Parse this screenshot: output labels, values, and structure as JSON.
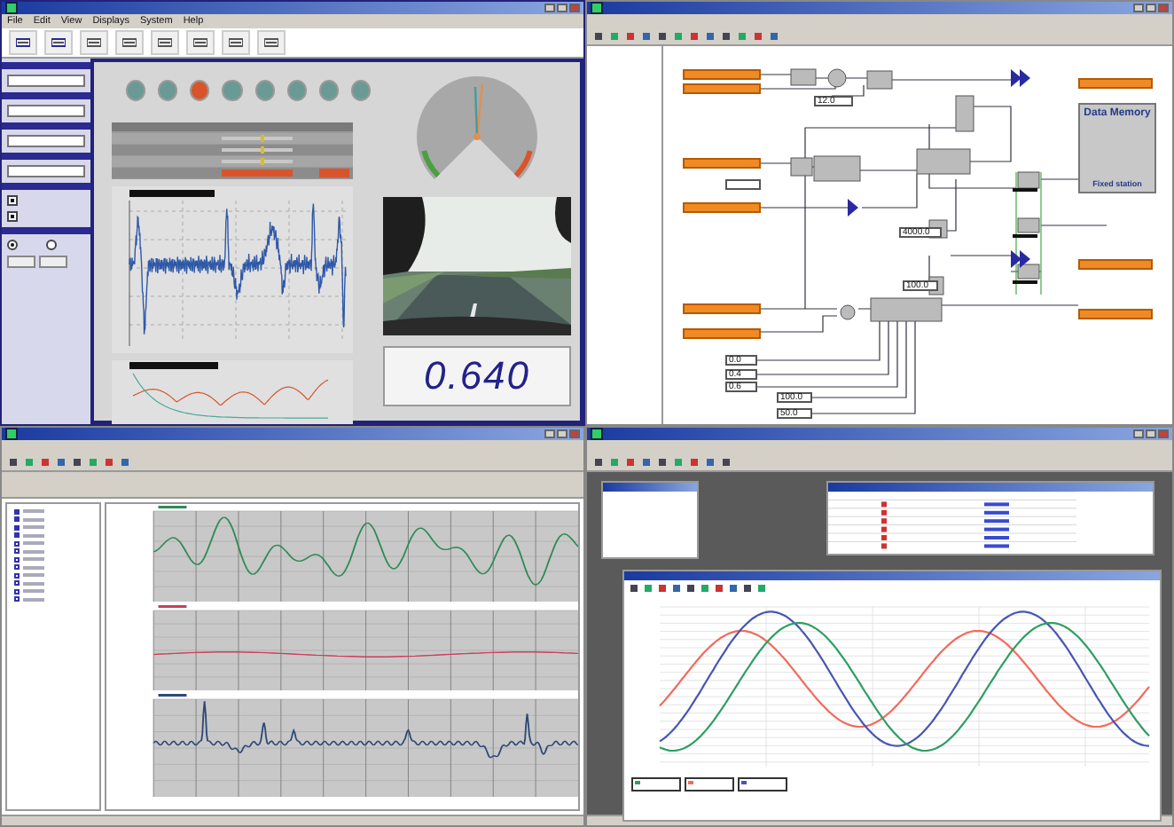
{
  "measurement_window": {
    "menu": [
      "File",
      "Edit",
      "View",
      "Displays",
      "System",
      "Help"
    ],
    "lamps": [
      {
        "on": false
      },
      {
        "on": false
      },
      {
        "on": true
      },
      {
        "on": false
      },
      {
        "on": false
      },
      {
        "on": false
      },
      {
        "on": false
      },
      {
        "on": false
      }
    ],
    "options": [
      {
        "checked": true
      },
      {
        "checked": true
      }
    ],
    "mode": [
      {
        "selected": true
      },
      {
        "selected": false
      }
    ],
    "display": {
      "value": "0.640"
    }
  },
  "block_diagram_window": {
    "data_memory": {
      "title": "Data Memory",
      "footer": "Fixed station"
    },
    "constants": [
      "12.0",
      "4000.0",
      "100.0",
      "0.0",
      "0.4",
      "0.6",
      "100.0",
      "50.0"
    ]
  },
  "recorder_window": {
    "channels": [
      {
        "checked": true
      },
      {
        "checked": true
      },
      {
        "checked": true
      },
      {
        "checked": true
      },
      {
        "checked": false
      },
      {
        "checked": false
      },
      {
        "checked": false
      },
      {
        "checked": false
      },
      {
        "checked": false
      },
      {
        "checked": false
      },
      {
        "checked": false
      },
      {
        "checked": false
      }
    ]
  },
  "scope_window": {
    "legend": [
      {
        "color": "#2e9e62"
      },
      {
        "color": "#f26a5a"
      },
      {
        "color": "#4656b4"
      }
    ]
  }
}
